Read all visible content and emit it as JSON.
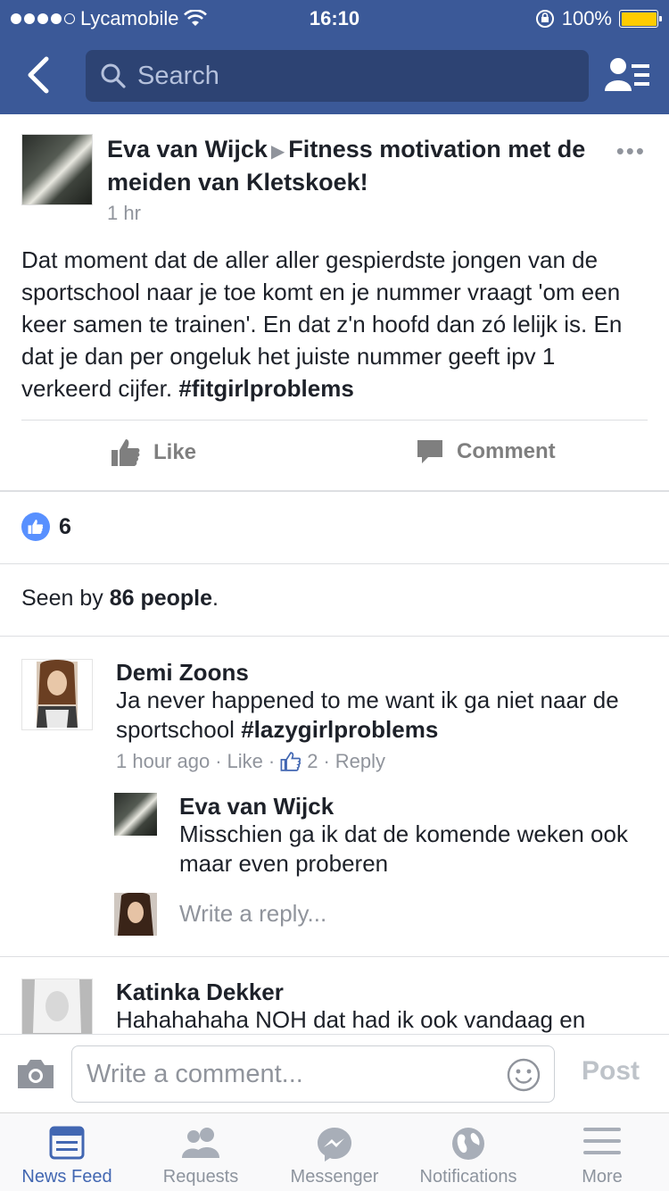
{
  "status_bar": {
    "carrier": "Lycamobile",
    "time": "16:10",
    "battery": "100%"
  },
  "nav": {
    "search_placeholder": "Search"
  },
  "post": {
    "author": "Eva van Wijck",
    "group": "Fitness motivation met de meiden van Kletskoek!",
    "time": "1 hr",
    "body": "Dat moment dat de aller aller gespierdste jongen van de sportschool naar je toe komt en je nummer vraagt 'om een keer samen te trainen'. En dat z'n hoofd dan zó lelijk is. En dat je dan per ongeluk het juiste nummer geeft ipv 1 verkeerd cijfer.",
    "hashtag": "#fitgirlproblems",
    "like_label": "Like",
    "comment_label": "Comment",
    "like_count": "6",
    "seen_prefix": "Seen by",
    "seen_count": "86 people",
    "seen_suffix": "."
  },
  "comments": [
    {
      "name": "Demi Zoons",
      "text": "Ja never happened to me want ik ga niet naar de sportschool",
      "hashtag": "#lazygirlproblems",
      "time": "1 hour ago",
      "like_label": "Like",
      "like_count": "2",
      "reply_label": "Reply",
      "reply": {
        "name": "Eva van Wijck",
        "text": "Misschien ga ik dat de komende weken ook maar even proberen"
      },
      "reply_placeholder": "Write a reply..."
    },
    {
      "name": "Katinka Dekker",
      "text": "Hahahahaha NOH dat had ik ook vandaag en"
    }
  ],
  "composer": {
    "placeholder": "Write a comment...",
    "post_label": "Post"
  },
  "tabs": [
    {
      "label": "News Feed",
      "icon": "news-feed-icon",
      "active": true
    },
    {
      "label": "Requests",
      "icon": "requests-icon",
      "active": false
    },
    {
      "label": "Messenger",
      "icon": "messenger-icon",
      "active": false
    },
    {
      "label": "Notifications",
      "icon": "notifications-icon",
      "active": false
    },
    {
      "label": "More",
      "icon": "more-icon",
      "active": false
    }
  ],
  "colors": {
    "brand": "#3b5998",
    "active_tab": "#4267b2",
    "like_blue": "#5890ff",
    "battery": "#ffcc00"
  }
}
